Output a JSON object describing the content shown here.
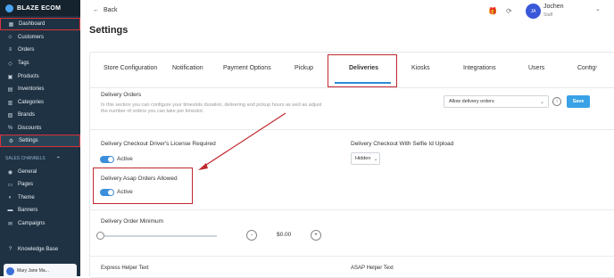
{
  "sidebar": {
    "brand": "BLAZE ECOM",
    "items": [
      {
        "label": "Dashboard",
        "icon": "dashboard-icon",
        "glyph": "▦"
      },
      {
        "label": "Customers",
        "icon": "users-icon",
        "glyph": "☺"
      },
      {
        "label": "Orders",
        "icon": "orders-icon",
        "glyph": "≡"
      },
      {
        "label": "Tags",
        "icon": "tag-icon",
        "glyph": "◇"
      },
      {
        "label": "Products",
        "icon": "products-icon",
        "glyph": "▣"
      },
      {
        "label": "Inventories",
        "icon": "inventory-icon",
        "glyph": "▤"
      },
      {
        "label": "Categories",
        "icon": "categories-icon",
        "glyph": "▥"
      },
      {
        "label": "Brands",
        "icon": "brands-icon",
        "glyph": "▧"
      },
      {
        "label": "Discounts",
        "icon": "discounts-icon",
        "glyph": "%"
      },
      {
        "label": "Settings",
        "icon": "gear-icon",
        "glyph": "⚙"
      }
    ],
    "sales_channels_label": "SALES CHANNELS",
    "channel_items": [
      {
        "label": "General",
        "icon": "general-icon",
        "glyph": "◉"
      },
      {
        "label": "Pages",
        "icon": "pages-icon",
        "glyph": "▭"
      },
      {
        "label": "Theme",
        "icon": "theme-icon",
        "glyph": "◐"
      },
      {
        "label": "Banners",
        "icon": "banners-icon",
        "glyph": "▬"
      },
      {
        "label": "Campaigns",
        "icon": "campaigns-icon",
        "glyph": "✉"
      }
    ],
    "knowledge_base": {
      "label": "Knowledge Base",
      "icon": "question-icon",
      "glyph": "?"
    },
    "user_card": {
      "name": "Mary Jane Ma..."
    }
  },
  "header": {
    "back_label": "Back",
    "user_initials": "JA",
    "user_name": "Jochen",
    "user_role": "Staff"
  },
  "page_title": "Settings",
  "tabs": [
    {
      "label": "Store Configuration"
    },
    {
      "label": "Notification"
    },
    {
      "label": "Payment Options"
    },
    {
      "label": "Pickup"
    },
    {
      "label": "Deliveries"
    },
    {
      "label": "Kiosks"
    },
    {
      "label": "Integrations"
    },
    {
      "label": "Users"
    },
    {
      "label": "Configs"
    }
  ],
  "active_tab": "Deliveries",
  "delivery_orders": {
    "title": "Delivery Orders",
    "description_line1": "In this section you can configure your timeslots duration, delivering and pickup hours as well as adjust",
    "description_line2": "the number of orders you can take per timeslot.",
    "select_value": "Allow delivery orders",
    "save_label": "Save"
  },
  "license": {
    "title": "Delivery Checkout Driver's License Required",
    "state": "Active"
  },
  "selfie": {
    "title": "Delivery Checkout With Selfie Id Upload",
    "select_value": "Hidden"
  },
  "asap": {
    "title": "Delivery Asap Orders Allowed",
    "state": "Active"
  },
  "order_minimum": {
    "title": "Delivery Order Minimum",
    "amount": "$0.00",
    "slider_level": 0
  },
  "helper_texts": {
    "express": "Express Helper Text",
    "asap": "ASAP Helper Text"
  },
  "colors": {
    "sidebar": "#1f3243",
    "accent": "#39a1e6",
    "highlight_red": "#c0282f"
  }
}
